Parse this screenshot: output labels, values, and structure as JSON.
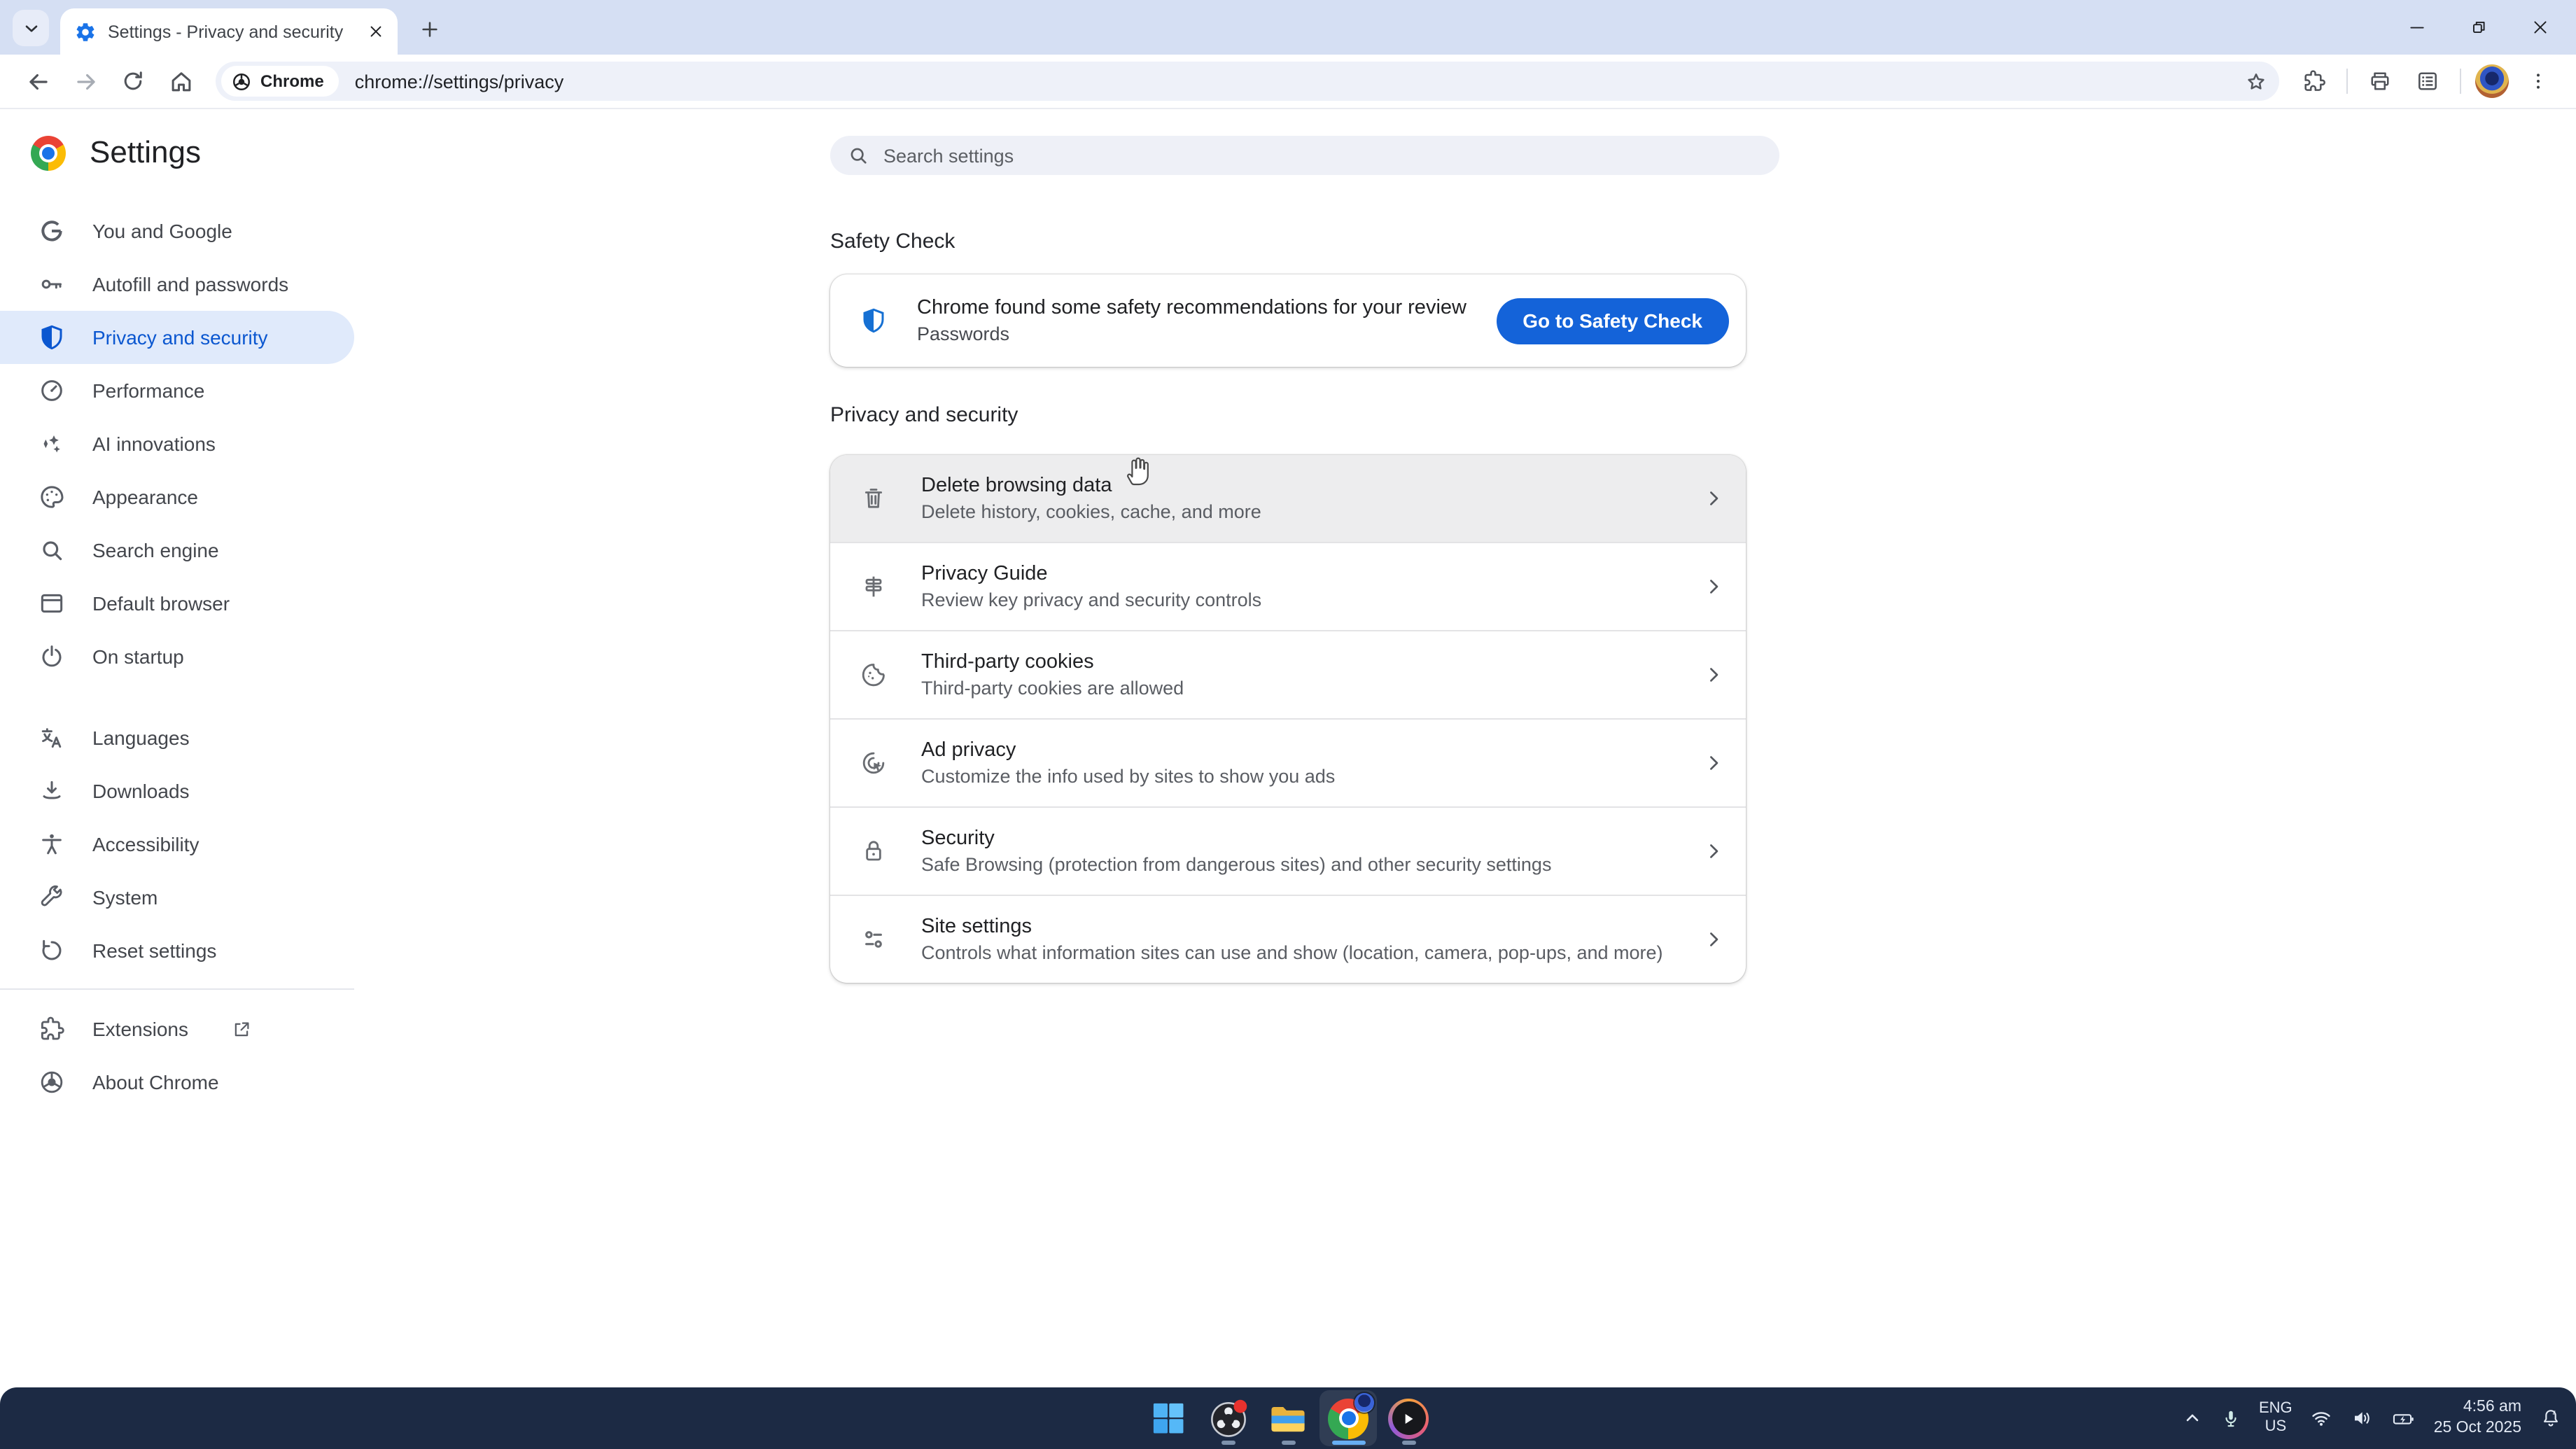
{
  "browser": {
    "tab": {
      "title": "Settings - Privacy and security"
    },
    "address": {
      "chip": "Chrome",
      "url": "chrome://settings/privacy"
    }
  },
  "settings": {
    "title": "Settings",
    "search_placeholder": "Search settings",
    "sidebar": [
      {
        "icon": "google-g-icon",
        "label": "You and Google"
      },
      {
        "icon": "key-icon",
        "label": "Autofill and passwords"
      },
      {
        "icon": "shield-icon",
        "label": "Privacy and security",
        "selected": true
      },
      {
        "icon": "speedometer-icon",
        "label": "Performance"
      },
      {
        "icon": "sparkle-icon",
        "label": "AI innovations"
      },
      {
        "icon": "palette-icon",
        "label": "Appearance"
      },
      {
        "icon": "search-icon",
        "label": "Search engine"
      },
      {
        "icon": "browser-window-icon",
        "label": "Default browser"
      },
      {
        "icon": "power-icon",
        "label": "On startup"
      }
    ],
    "sidebar_secondary": [
      {
        "icon": "translate-icon",
        "label": "Languages"
      },
      {
        "icon": "download-icon",
        "label": "Downloads"
      },
      {
        "icon": "accessibility-icon",
        "label": "Accessibility"
      },
      {
        "icon": "wrench-icon",
        "label": "System"
      },
      {
        "icon": "reset-icon",
        "label": "Reset settings"
      }
    ],
    "sidebar_footer": [
      {
        "icon": "puzzle-icon",
        "label": "Extensions",
        "external": true
      },
      {
        "icon": "chrome-gray-icon",
        "label": "About Chrome"
      }
    ],
    "safety_check": {
      "heading": "Safety Check",
      "message": "Chrome found some safety recommendations for your review",
      "detail": "Passwords",
      "button": "Go to Safety Check"
    },
    "privacy": {
      "heading": "Privacy and security",
      "rows": [
        {
          "icon": "trash-icon",
          "title": "Delete browsing data",
          "subtitle": "Delete history, cookies, cache, and more",
          "hover": true
        },
        {
          "icon": "signpost-icon",
          "title": "Privacy Guide",
          "subtitle": "Review key privacy and security controls"
        },
        {
          "icon": "cookie-icon",
          "title": "Third-party cookies",
          "subtitle": "Third-party cookies are allowed"
        },
        {
          "icon": "ad-target-icon",
          "title": "Ad privacy",
          "subtitle": "Customize the info used by sites to show you ads"
        },
        {
          "icon": "lock-icon",
          "title": "Security",
          "subtitle": "Safe Browsing (protection from dangerous sites) and other security settings"
        },
        {
          "icon": "sliders-icon",
          "title": "Site settings",
          "subtitle": "Controls what information sites can use and show (location, camera, pop-ups, and more)"
        }
      ]
    }
  },
  "taskbar": {
    "language": {
      "line1": "ENG",
      "line2": "US"
    },
    "clock": {
      "time": "4:56 am",
      "date": "25 Oct 2025"
    }
  },
  "colors": {
    "accent_blue": "#1463d9",
    "selected_blue": "#0b57d0",
    "tabstrip": "#d5dff3",
    "taskbar": "#1c2a44"
  }
}
